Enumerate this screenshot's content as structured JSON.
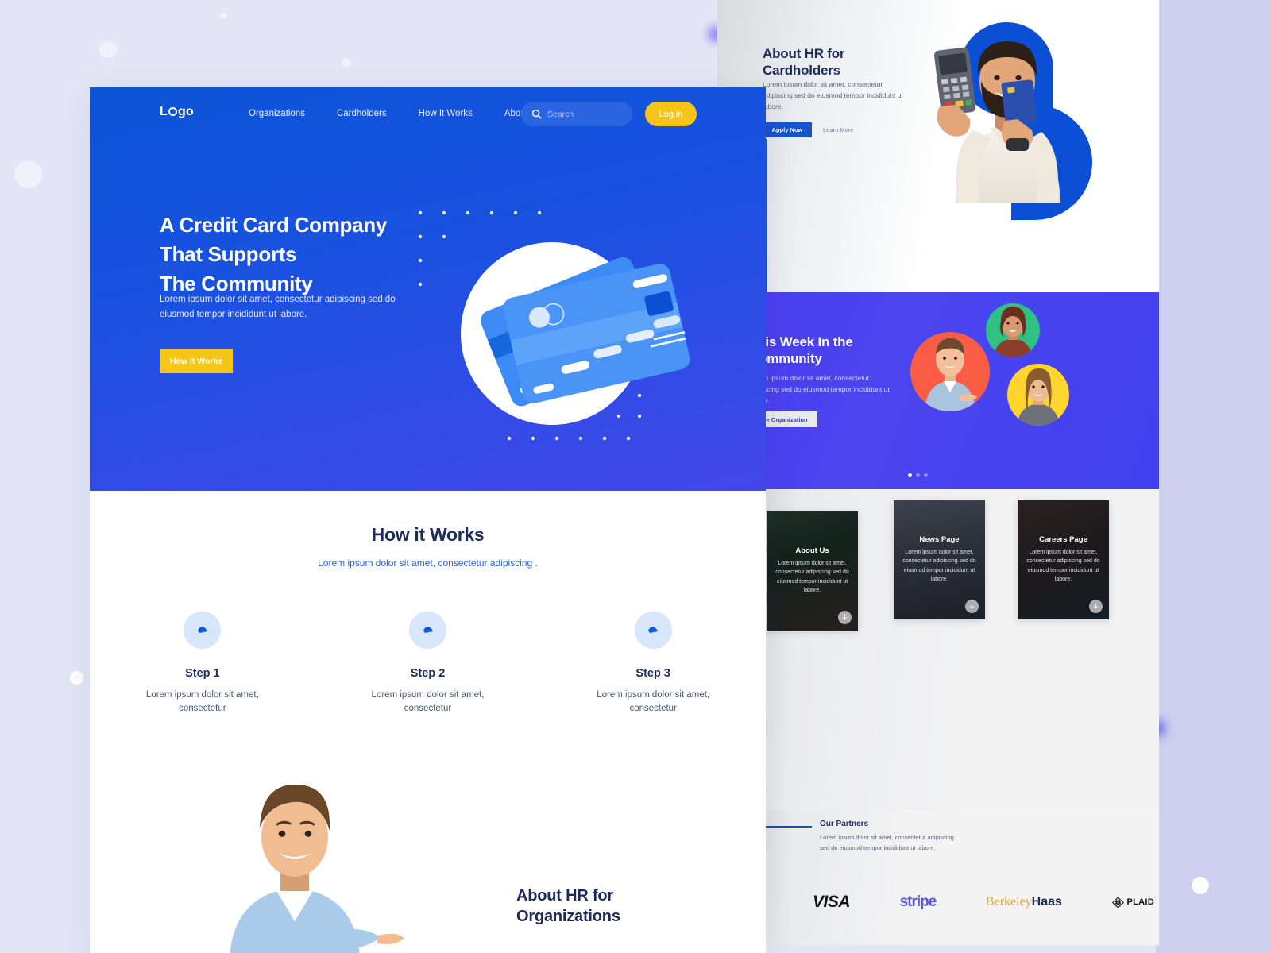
{
  "backdrop": {
    "bg_color": "#e4e6f7",
    "right_band_color": "#cdd0ef"
  },
  "main_page": {
    "nav": {
      "logo": "Logo",
      "logo_parts": {
        "pre": "L",
        "post": "go"
      },
      "links": [
        {
          "label": "Organizations"
        },
        {
          "label": "Cardholders"
        },
        {
          "label": "How It Works"
        },
        {
          "label": "About"
        }
      ],
      "search_placeholder": "Search",
      "search_icon": "search-icon",
      "login_label": "Log in",
      "login_color": "#f5c518"
    },
    "hero": {
      "heading_line1": "A Credit Card Company",
      "heading_line2": "That Supports",
      "heading_line3": "The Community",
      "subtext": "Lorem ipsum dolor sit amet, consectetur adipiscing sed do  eiusmod tempor incididunt ut labore.",
      "cta_label": "How It Works",
      "gradient_start": "#0b55d6",
      "gradient_end": "#4447ea"
    },
    "how_it_works": {
      "title": "How it Works",
      "subtitle": "Lorem ipsum dolor sit amet, consectetur adipiscing .",
      "steps": [
        {
          "title": "Step 1",
          "body": "Lorem ipsum dolor sit amet, consectetur"
        },
        {
          "title": "Step 2",
          "body": "Lorem ipsum dolor sit amet, consectetur"
        },
        {
          "title": "Step 3",
          "body": "Lorem ipsum dolor sit amet, consectetur"
        }
      ]
    },
    "about_organizations": {
      "title_line1": "About HR for",
      "title_line2": "Organizations"
    }
  },
  "back_page": {
    "cardholders": {
      "title_line1": "About HR for",
      "title_line2": "Cardholders",
      "body": "Lorem ipsum dolor sit amet, consectetur adipiscing sed do  eiusmod tempor incididunt ut labore.",
      "primary_label": "Apply Now",
      "secondary_label": "Learn More"
    },
    "community": {
      "title_line1": "This Week In the",
      "title_line2": "Community",
      "body": "Lorem ipsum dolor sit amet, consectetur adipiscing sed do  eiusmod tempor incididunt ut labore.",
      "cta_label": "See Organization",
      "carousel_dots": 3,
      "active_dot": 1,
      "avatars": [
        {
          "name": "avatar-man-pointing",
          "bg": "#fa5c45"
        },
        {
          "name": "avatar-woman-curly",
          "bg": "#2fc083"
        },
        {
          "name": "avatar-woman-long-hair",
          "bg": "#ffd52e"
        }
      ]
    },
    "cards": [
      {
        "title": "About Us",
        "body": "Lorem ipsum dolor sit amet, consectetur adipiscing sed do  eiusmod tempor incididunt ut labore."
      },
      {
        "title": "News Page",
        "body": "Lorem ipsum dolor sit amet, consectetur adipiscing sed do  eiusmod tempor incididunt ut labore."
      },
      {
        "title": "Careers Page",
        "body": "Lorem ipsum dolor sit amet, consectetur adipiscing sed do  eiusmod tempor incididunt ut labore."
      }
    ],
    "partners": {
      "title": "Our Partners",
      "body": "Lorem ipsum dolor sit amet, consectetur adipiscing sed do  eiusmod tempor incididunt ut labore.",
      "logos": [
        {
          "name": "visa-logo",
          "text": "VISA"
        },
        {
          "name": "stripe-logo",
          "text": "stripe"
        },
        {
          "name": "berkeley-haas-logo",
          "text": "BerkeleyHaas",
          "part1": "Berkeley",
          "part2": "Haas"
        },
        {
          "name": "plaid-logo",
          "text": "PLAID"
        }
      ]
    }
  }
}
